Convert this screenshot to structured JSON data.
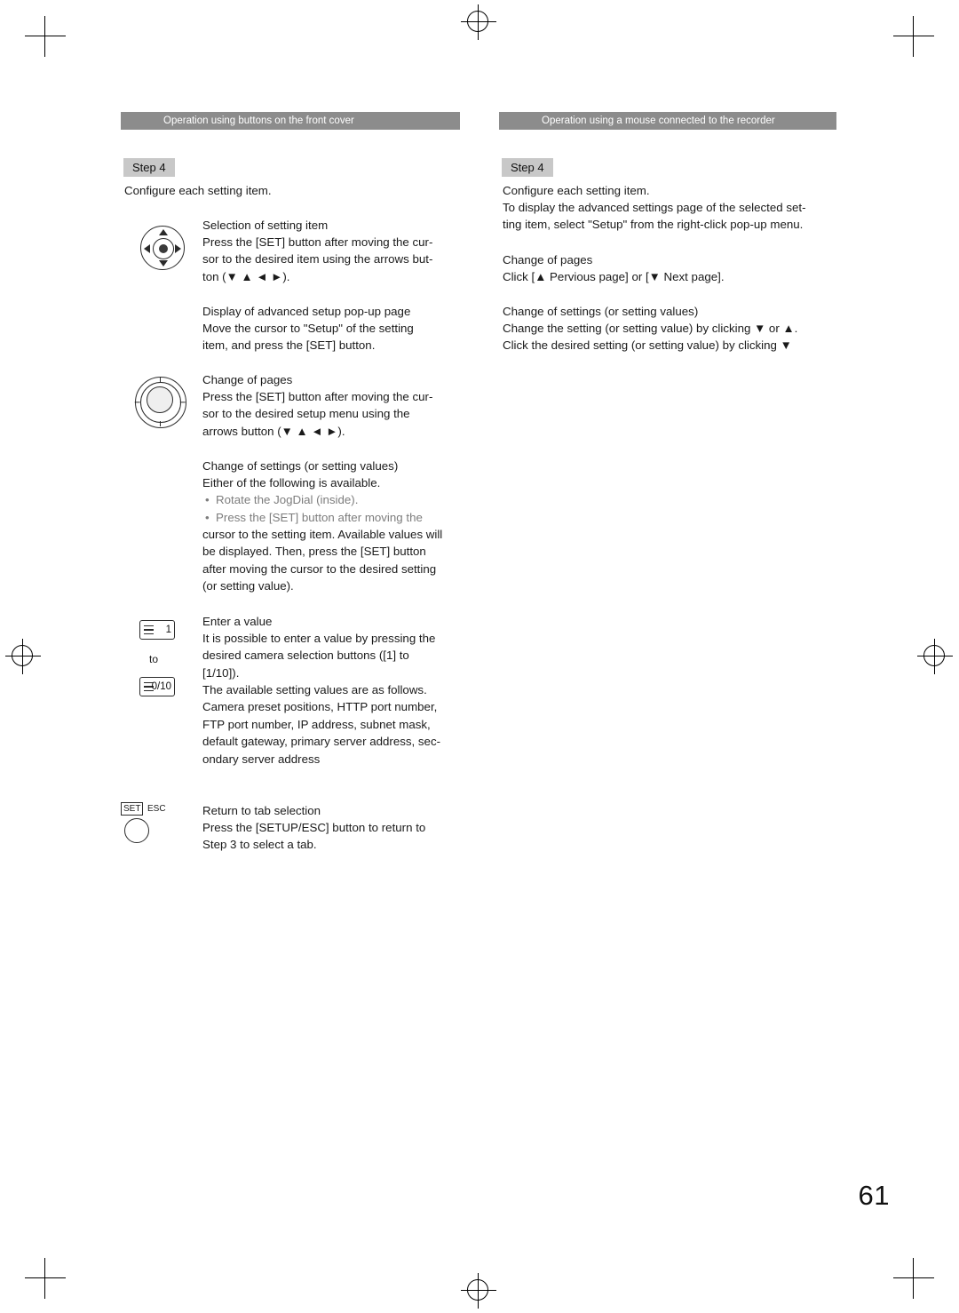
{
  "page": {
    "number": "61"
  },
  "columns": {
    "left": {
      "header": "Operation using buttons on the front cover",
      "step_label": "Step  4",
      "intro": "Configure each setting item.",
      "sections": [
        {
          "heading": "Selection of setting item",
          "body": "Press the [SET] button after moving the cur-\nsor to the desired item using the arrows but-\nton (▼ ▲ ◄ ►)."
        },
        {
          "heading": "Display of advanced setup pop-up page",
          "body": "Move the cursor to \"Setup\" of the setting\nitem, and press the [SET] button."
        },
        {
          "heading": "Change of pages",
          "body": "Press the [SET] button after moving the cur-\nsor to the desired setup menu using the\narrows button (▼ ▲ ◄ ►)."
        },
        {
          "heading": "Change of settings (or setting values)",
          "body": "Either of the following is available."
        }
      ],
      "bullets": [
        "•  Rotate the JogDial (inside).",
        "•  Press the [SET] button after moving the"
      ],
      "bullet_continuation": "cursor to the setting item. Available values will\nbe displayed. Then, press the [SET] button\nafter moving the cursor to the desired setting\n(or setting value).",
      "enter_value": {
        "heading": "Enter a value",
        "body": "It is possible to enter a value by pressing the\ndesired camera selection buttons ([1] to\n[1/10]).",
        "body2": "The available setting values are as follows.\nCamera preset positions, HTTP port number,\nFTP port number, IP address, subnet mask,\ndefault gateway, primary server address, sec-\nondary server address"
      },
      "return_tab": {
        "heading": "Return to tab selection",
        "body": "Press the [SETUP/ESC] button to return to\nStep 3 to select a tab."
      },
      "icons": {
        "arrow_pad": "arrow-pad-icon",
        "jog_dial": "jog-dial-icon",
        "camera_button_1": "1",
        "camera_button_to": "to",
        "camera_button_10": "0/10",
        "set_label": "SET",
        "esc_label": "ESC"
      }
    },
    "right": {
      "header": "Operation using a mouse connected to the recorder",
      "step_label": "Step  4",
      "intro": "Configure each setting item.",
      "paragraphs": [
        "To display the advanced settings page of the selected set-\nting item, select \"Setup\" from the right-click pop-up menu."
      ],
      "sections": [
        {
          "heading": "Change of pages",
          "body": "Click [▲ Pervious page] or [▼ Next page]."
        },
        {
          "heading": "Change of settings (or setting values)",
          "body": "Change the setting (or setting value) by clicking ▼ or ▲.\nClick the desired setting (or setting value) by clicking ▼"
        }
      ]
    }
  }
}
